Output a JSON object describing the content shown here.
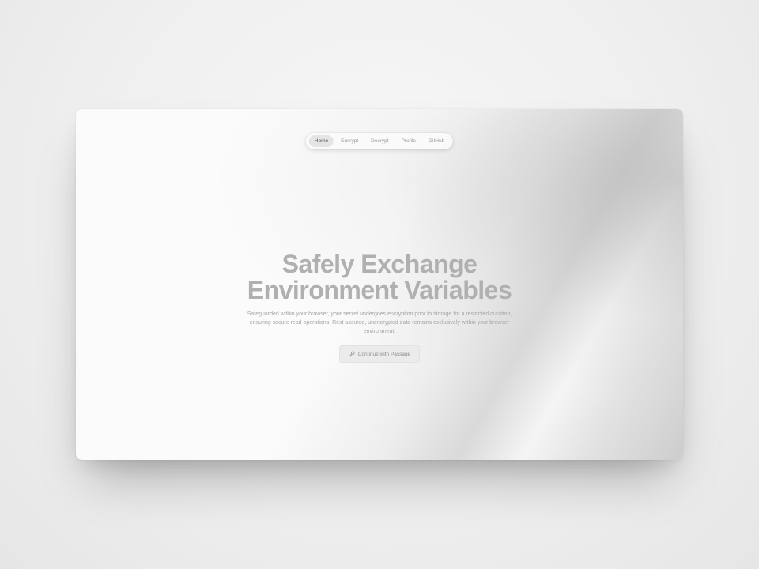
{
  "nav": {
    "items": [
      {
        "label": "Home",
        "active": true
      },
      {
        "label": "Encrypt",
        "active": false
      },
      {
        "label": "Decrypt",
        "active": false
      },
      {
        "label": "Profile",
        "active": false
      },
      {
        "label": "GitHub",
        "active": false
      }
    ]
  },
  "hero": {
    "title_line1": "Safely Exchange",
    "title_line2": "Environment Variables",
    "subtitle": "Safeguarded within your browser, your secret undergoes encryption prior to storage for a restricted duration, ensuring secure read operations. Rest assured, unencrypted data remains exclusively within your browser environment.",
    "cta_label": "Continue with Passage",
    "cta_icon": "key-icon"
  }
}
